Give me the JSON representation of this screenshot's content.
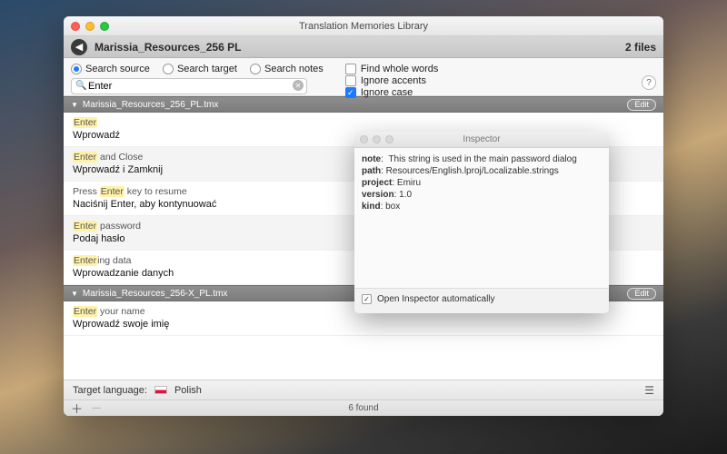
{
  "window": {
    "title": "Translation Memories Library"
  },
  "header": {
    "title": "Marissia_Resources_256 PL",
    "file_count": "2 files"
  },
  "toolbar": {
    "radio_source": "Search source",
    "radio_target": "Search target",
    "radio_notes": "Search notes",
    "check_whole": "Find whole words",
    "check_accents": "Ignore accents",
    "check_case": "Ignore case",
    "search_value": "Enter",
    "search_placeholder": "Search"
  },
  "sections": [
    {
      "name": "Marissia_Resources_256_PL.tmx",
      "edit": "Edit",
      "rows": [
        {
          "src_pre": "",
          "src_hl": "Enter",
          "src_post": "",
          "tgt": "Wprowadź"
        },
        {
          "src_pre": "",
          "src_hl": "Enter",
          "src_post": " and Close",
          "tgt": "Wprowadź i Zamknij"
        },
        {
          "src_pre": "Press ",
          "src_hl": "Enter",
          "src_post": " key to resume",
          "tgt": "Naciśnij Enter, aby kontynuować"
        },
        {
          "src_pre": "",
          "src_hl": "Enter",
          "src_post": " password",
          "tgt": "Podaj hasło"
        },
        {
          "src_pre": "",
          "src_hl": "Enter",
          "src_post": "ing data",
          "tgt": "Wprowadzanie danych"
        }
      ]
    },
    {
      "name": "Marissia_Resources_256-X_PL.tmx",
      "edit": "Edit",
      "rows": [
        {
          "src_pre": "",
          "src_hl": "Enter",
          "src_post": " your name",
          "tgt": "Wprowadź swoje imię"
        }
      ]
    }
  ],
  "footer": {
    "target_lang_label": "Target language:",
    "target_lang_value": "Polish",
    "found": "6 found"
  },
  "inspector": {
    "title": "Inspector",
    "note_k": "note",
    "note_v": "This string is used in the main password dialog",
    "path_k": "path",
    "path_v": "Resources/English.lproj/Localizable.strings",
    "project_k": "project",
    "project_v": "Emiru",
    "version_k": "version",
    "version_v": "1.0",
    "kind_k": "kind",
    "kind_v": "box",
    "auto_label": "Open Inspector automatically"
  }
}
